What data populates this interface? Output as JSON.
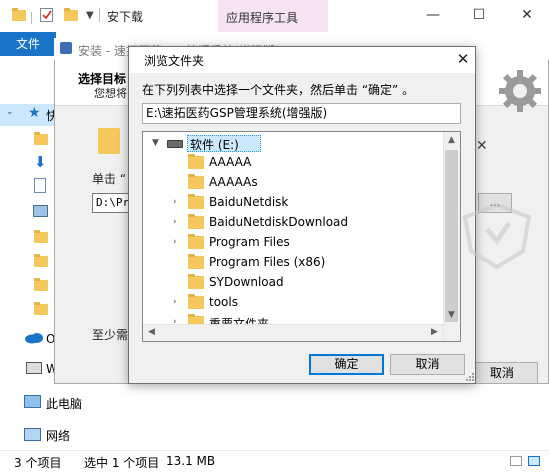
{
  "explorer": {
    "title": "安下载",
    "context_tab": "应用程序工具",
    "file_tab": "文件",
    "nav_items": [
      {
        "label": "快",
        "icon": "star-icon"
      },
      {
        "label": "",
        "icon": "folder-icon"
      },
      {
        "label": "",
        "icon": "download-arrow-icon"
      },
      {
        "label": "",
        "icon": "document-icon"
      },
      {
        "label": "",
        "icon": "image-icon"
      },
      {
        "label": "",
        "icon": "folder-icon"
      },
      {
        "label": "",
        "icon": "folder-icon"
      },
      {
        "label": "",
        "icon": "folder-icon"
      },
      {
        "label": "",
        "icon": "folder-icon"
      }
    ],
    "onedrive_label": "O",
    "w_label": "W",
    "this_pc_label": "此电脑",
    "network_label": "网络",
    "status": {
      "items_count": "3 个项目",
      "selected": "选中 1 个项目",
      "size": "13.1 MB"
    }
  },
  "installer": {
    "title": "安装 - 速拓医药GSP管理系统(增强版)",
    "heading": "选择目标",
    "subheading": "您想将",
    "single_click_text": "单击 “",
    "path_value": "D:\\Pr",
    "browse_label": "...",
    "min_space_text": "至少需",
    "cancel_label": "取消"
  },
  "dialog": {
    "title": "浏览文件夹",
    "prompt": "在下列列表中选择一个文件夹，然后单击 “确定” 。",
    "path_value": "E:\\速拓医药GSP管理系统(增强版)",
    "drive_label": "软件 (E:)",
    "folders": [
      {
        "name": "AAAAA",
        "expandable": false
      },
      {
        "name": "AAAAAs",
        "expandable": false
      },
      {
        "name": "BaiduNetdisk",
        "expandable": true
      },
      {
        "name": "BaiduNetdiskDownload",
        "expandable": true
      },
      {
        "name": "Program Files",
        "expandable": true
      },
      {
        "name": "Program Files (x86)",
        "expandable": false
      },
      {
        "name": "SYDownload",
        "expandable": false
      },
      {
        "name": "tools",
        "expandable": true
      },
      {
        "name": "重要文件夹",
        "expandable": true
      }
    ],
    "ok_label": "确定",
    "cancel_label": "取消"
  },
  "colors": {
    "accent": "#0078d7",
    "file_tab": "#1a73c7",
    "folder": "#f4c85a",
    "selection": "#cce8ff"
  }
}
